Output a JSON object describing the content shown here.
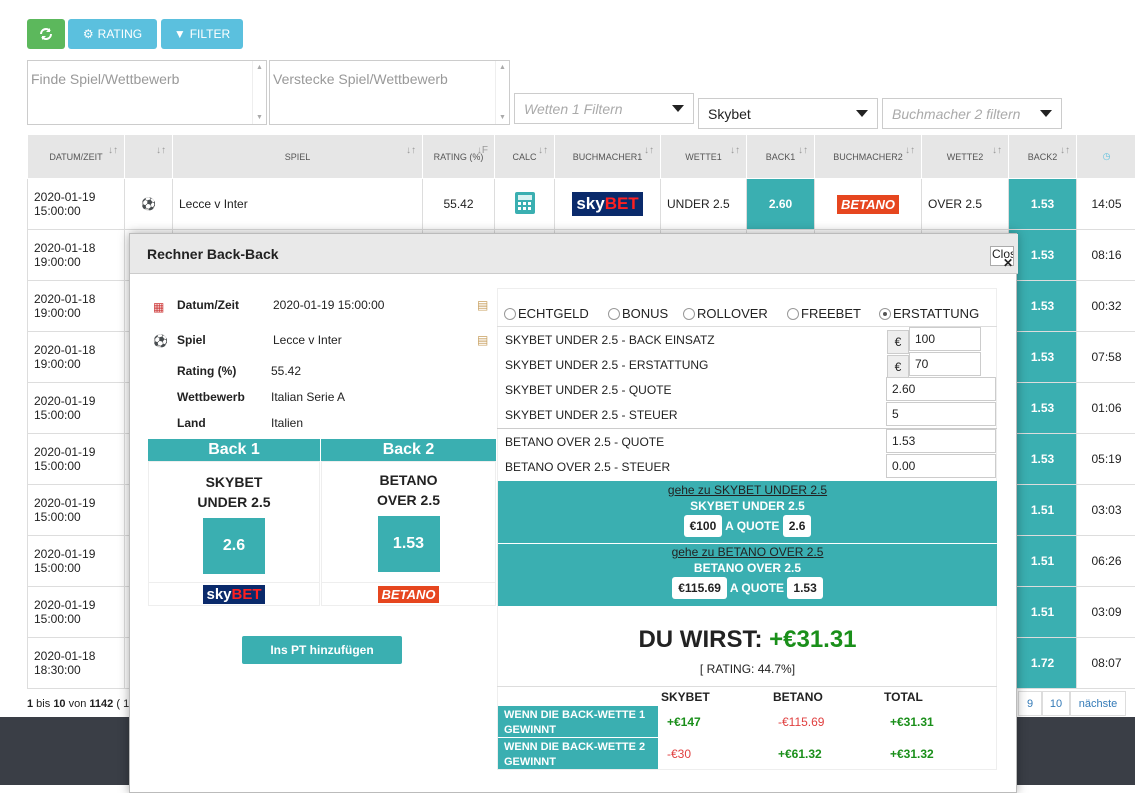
{
  "toolbar": {
    "rating_label": "RATING",
    "filter_label": "FILTER"
  },
  "filters": {
    "find_placeholder": "Finde Spiel/Wettbewerb",
    "hide_placeholder": "Verstecke Spiel/Wettbewerb",
    "bets_placeholder": "Wetten 1 Filtern",
    "bookmaker1": "Skybet",
    "bookmaker2_placeholder": "Buchmacher 2 filtern"
  },
  "table": {
    "headers": {
      "date": "DATUM/ZEIT",
      "game": "SPIEL",
      "rating": "RATING (%)",
      "calc": "CALC",
      "bm1": "BUCHMACHER1",
      "bet1": "WETTE1",
      "back1": "BACK1",
      "bm2": "BUCHMACHER2",
      "bet2": "WETTE2",
      "back2": "BACK2"
    },
    "row1": {
      "date": "2020-01-19",
      "time": "15:00:00",
      "game": "Lecce v Inter",
      "rating": "55.42",
      "bet1": "UNDER 2.5",
      "back1": "2.60",
      "bet2": "OVER 2.5",
      "back2": "1.53",
      "timer": "14:05"
    },
    "rows": [
      {
        "date": "2020-01-18",
        "time": "19:00:00",
        "back2": "1.53",
        "timer": "08:16"
      },
      {
        "date": "2020-01-18",
        "time": "19:00:00",
        "back2": "1.53",
        "timer": "00:32"
      },
      {
        "date": "2020-01-18",
        "time": "19:00:00",
        "back2": "1.53",
        "timer": "07:58"
      },
      {
        "date": "2020-01-19",
        "time": "15:00:00",
        "back2": "1.53",
        "timer": "01:06"
      },
      {
        "date": "2020-01-19",
        "time": "15:00:00",
        "back2": "1.53",
        "timer": "05:19"
      },
      {
        "date": "2020-01-19",
        "time": "15:00:00",
        "back2": "1.51",
        "timer": "03:03"
      },
      {
        "date": "2020-01-19",
        "time": "15:00:00",
        "back2": "1.51",
        "timer": "06:26"
      },
      {
        "date": "2020-01-19",
        "time": "15:00:00",
        "back2": "1.51",
        "timer": "03:09"
      },
      {
        "date": "2020-01-18",
        "time": "18:30:00",
        "back2": "1.72",
        "timer": "08:07"
      }
    ]
  },
  "pager": {
    "p1": "1",
    "bis": " bis ",
    "p10": "10",
    "von": " von ",
    "total": "1142",
    "paren": " ( 1",
    "page9": "9",
    "page10": "10",
    "next": "nächste"
  },
  "logos": {
    "sky": "sky",
    "bet": "BET",
    "betano": "BETANO",
    "betano_sub": ".com"
  },
  "modal": {
    "title": "Rechner Back-Back",
    "close": "Close",
    "info": {
      "date_label": "Datum/Zeit",
      "date_value": "2020-01-19 15:00:00",
      "game_label": "Spiel",
      "game_value": "Lecce v Inter",
      "rating_label": "Rating (%)",
      "rating_value": "55.42",
      "comp_label": "Wettbewerb",
      "comp_value": "Italian Serie A",
      "country_label": "Land",
      "country_value": "Italien"
    },
    "back1": {
      "header": "Back 1",
      "line1": "SKYBET",
      "line2": "UNDER 2.5",
      "odd": "2.6"
    },
    "back2": {
      "header": "Back 2",
      "line1": "BETANO",
      "line2": "OVER 2.5",
      "odd": "1.53"
    },
    "add_button": "Ins PT hinzufügen",
    "radios": [
      "ECHTGELD",
      "BONUS",
      "ROLLOVER",
      "FREEBET",
      "ERSTATTUNG"
    ],
    "fields": {
      "stake_label": "SKYBET UNDER 2.5 - BACK EINSATZ",
      "stake": "100",
      "refund_label": "SKYBET UNDER 2.5 - ERSTATTUNG",
      "refund": "70",
      "quote1_label": "SKYBET UNDER 2.5 - QUOTE",
      "quote1": "2.60",
      "tax1_label": "SKYBET UNDER 2.5 - STEUER",
      "tax1": "5",
      "quote2_label": "BETANO OVER 2.5  - QUOTE",
      "quote2": "1.53",
      "tax2_label": "BETANO OVER 2.5 - STEUER",
      "tax2": "0.00",
      "currency": "€"
    },
    "go1": {
      "link": "gehe zu SKYBET UNDER 2.5",
      "title": "SKYBET UNDER 2.5",
      "amount": "€100",
      "a_quote": "A QUOTE",
      "quote": "2.6"
    },
    "go2": {
      "link": "gehe zu BETANO OVER 2.5",
      "title": "BETANO OVER 2.5",
      "amount": "€115.69",
      "a_quote": "A QUOTE",
      "quote": "1.53"
    },
    "result": {
      "label": "DU WIRST: ",
      "value": "+€31.31",
      "rating": "[ RATING: 44.7%]"
    },
    "summary": {
      "h_sky": "SKYBET",
      "h_bet": "BETANO",
      "h_total": "TOTAL",
      "row1_label": "WENN DIE BACK-WETTE 1 GEWINNT",
      "row1": [
        "+€147",
        "-€115.69",
        "+€31.31"
      ],
      "row2_label": "WENN DIE BACK-WETTE 2 GEWINNT",
      "row2": [
        "-€30",
        "+€61.32",
        "+€31.32"
      ]
    }
  }
}
